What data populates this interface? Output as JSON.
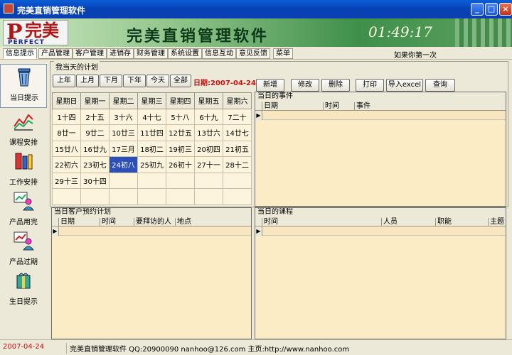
{
  "window": {
    "title": "完美直销管理软件"
  },
  "banner": {
    "logo_letter": "P",
    "logo_cn": "完美",
    "logo_en": "PERFECT",
    "title": "完美直销管理软件",
    "clock": "01:49:17"
  },
  "menu": {
    "items": [
      "信息提示",
      "产品管理",
      "客户管理",
      "进销存",
      "财务管理",
      "系统设置",
      "信息互动",
      "意见反馈",
      "菜单"
    ],
    "marquee": "如果你第一次"
  },
  "sidebar": {
    "items": [
      {
        "label": "当日提示",
        "icon": "trash-bin-icon"
      },
      {
        "label": "课程安排",
        "icon": "chart-icon"
      },
      {
        "label": "工作安排",
        "icon": "tools-icon"
      },
      {
        "label": "产品用完",
        "icon": "people-chart-icon"
      },
      {
        "label": "产品过期",
        "icon": "people-chart-icon"
      },
      {
        "label": "生日提示",
        "icon": "gift-icon"
      }
    ]
  },
  "plan": {
    "legend": "我当天的计划",
    "nav_buttons": [
      "上年",
      "上月",
      "下月",
      "下年",
      "今天",
      "全部"
    ],
    "date_label": "日期:2007-04-24",
    "weekdays": [
      "星期日",
      "星期一",
      "星期二",
      "星期三",
      "星期四",
      "星期五",
      "星期六"
    ],
    "weeks": [
      [
        "1十四",
        "2十五",
        "3十六",
        "4十七",
        "5十八",
        "6十九",
        "7二十"
      ],
      [
        "8廿一",
        "9廿二",
        "10廿三",
        "11廿四",
        "12廿五",
        "13廿六",
        "14廿七"
      ],
      [
        "15廿八",
        "16廿九",
        "17三月",
        "18初二",
        "19初三",
        "20初四",
        "21初五"
      ],
      [
        "22初六",
        "23初七",
        "24初八",
        "25初九",
        "26初十",
        "27十一",
        "28十二"
      ],
      [
        "29十三",
        "30十四",
        "",
        "",
        "",
        "",
        ""
      ],
      [
        "",
        "",
        "",
        "",
        "",
        "",
        ""
      ]
    ],
    "today": "24初八",
    "action_buttons": [
      "新增",
      "修改",
      "删除",
      "打印",
      "导入excel",
      "查询"
    ]
  },
  "events_grid": {
    "caption": "当日的事件",
    "columns": [
      "日期",
      "时间",
      "事件"
    ]
  },
  "customer_grid": {
    "caption": "当日客户预约计划",
    "columns": [
      "日期",
      "时间",
      "要拜访的人",
      "地点"
    ]
  },
  "course_grid": {
    "caption": "当日的课程",
    "columns": [
      "时间",
      "人员",
      "职能",
      "主题"
    ]
  },
  "status": {
    "date": "2007-04-24",
    "text": "完美直销管理软件 QQ:20900090 nanhoo@126.com 主页:http://www.nanhoo.com"
  },
  "colors": {
    "accent": "#0842b8",
    "today": "#2c4fb8",
    "date_red": "#c81010",
    "grid_row": "#f7e6c0"
  }
}
